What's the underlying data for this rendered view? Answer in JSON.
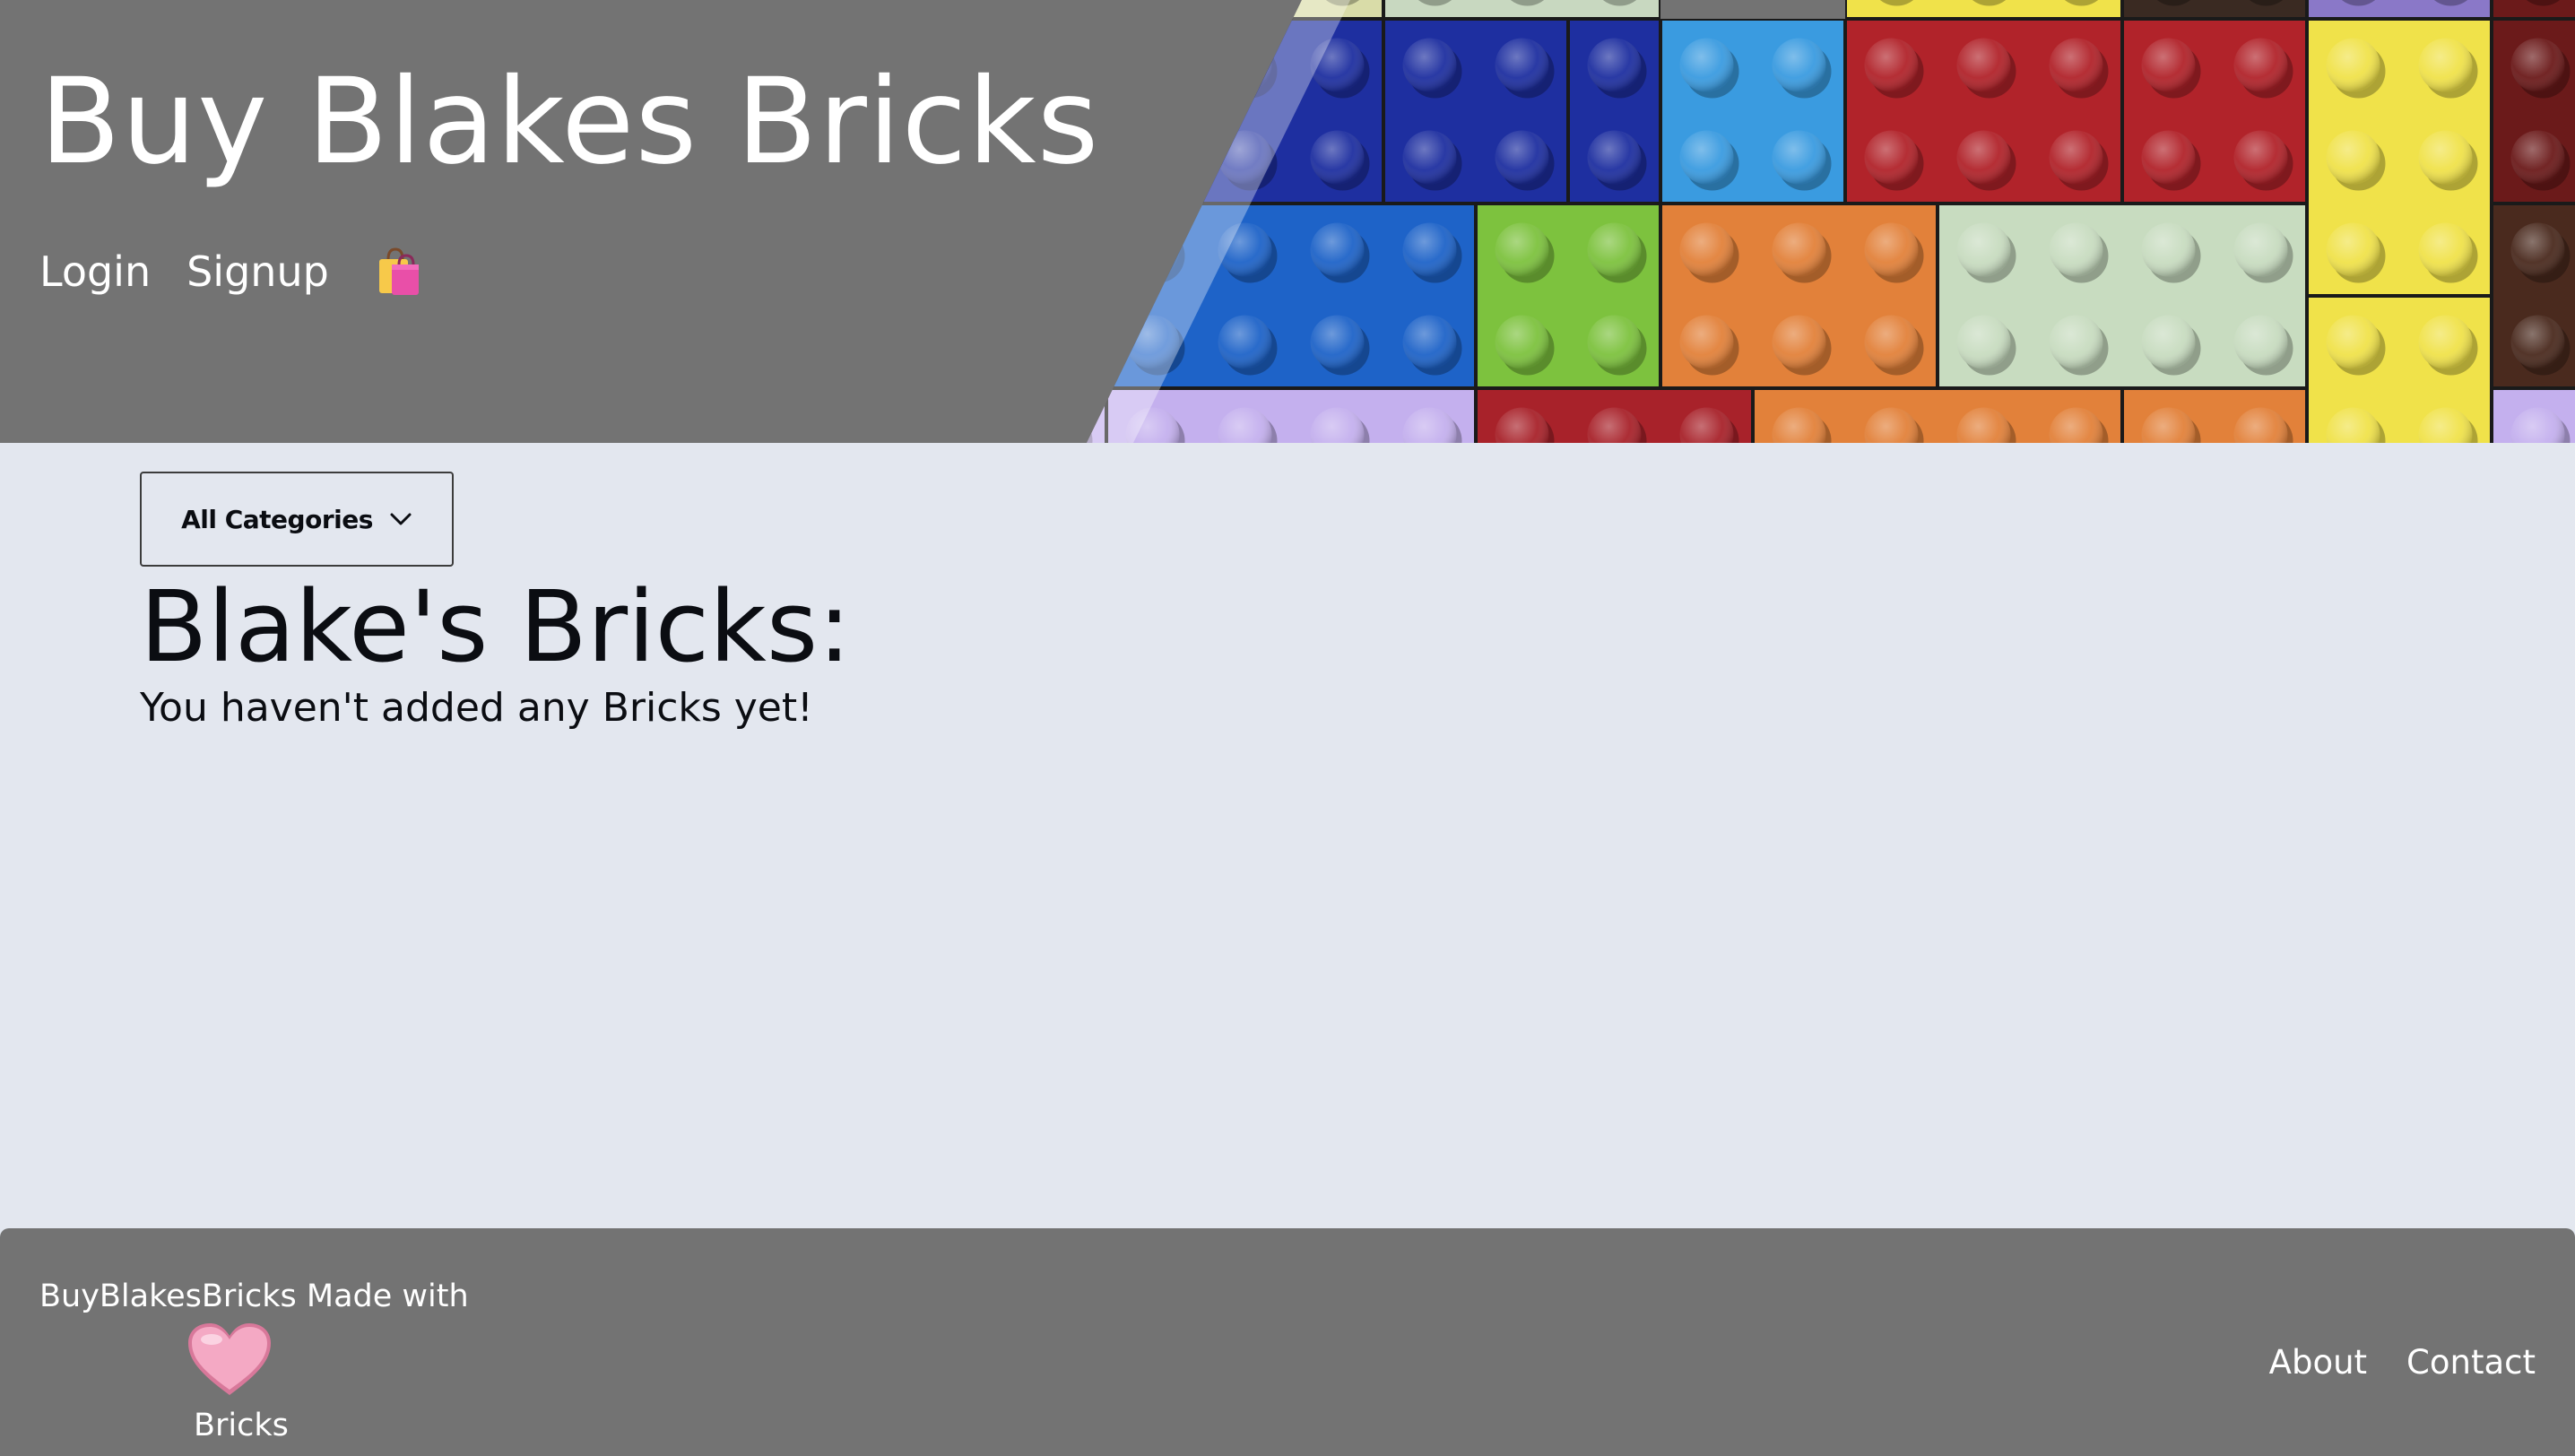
{
  "header": {
    "title": "Buy Blakes Bricks",
    "nav": {
      "login": "Login",
      "signup": "Signup",
      "cart_icon": "shopping-bags-icon"
    },
    "colors": {
      "background": "#737373",
      "text": "#ffffff"
    }
  },
  "main": {
    "category_dropdown": {
      "selected": "All Categories",
      "icon": "chevron-down-icon"
    },
    "title": "Blake's Bricks:",
    "empty_message": "You haven't added any Bricks yet!",
    "colors": {
      "background": "#e3e7ef",
      "text": "#0b0d12"
    }
  },
  "footer": {
    "credit_text": "BuyBlakesBricks Made with",
    "heart_icon": "pink-heart-icon",
    "credit_suffix": "Bricks",
    "links": {
      "about": "About",
      "contact": "Contact"
    }
  }
}
